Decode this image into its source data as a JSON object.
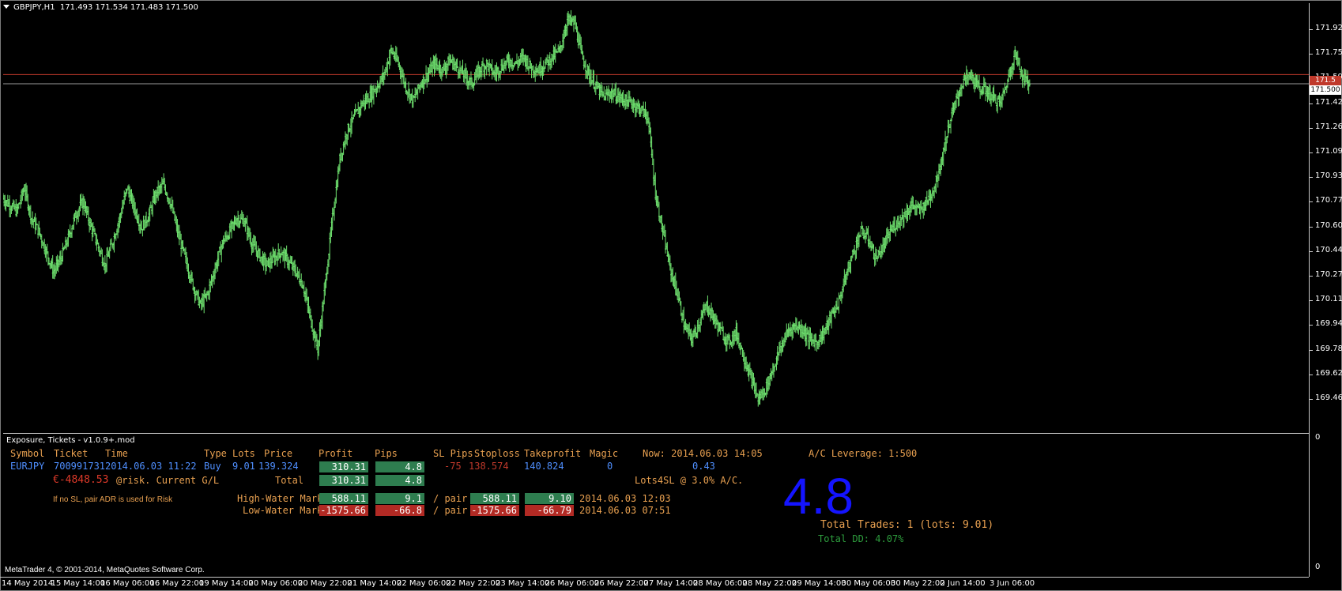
{
  "chart": {
    "title": "GBPJPY,H1  171.493 171.534 171.483 171.500",
    "y_ticks": [
      "171.920",
      "171.755",
      "171.590",
      "171.425",
      "171.260",
      "171.095",
      "170.930",
      "170.770",
      "170.605",
      "170.440",
      "170.275",
      "170.110",
      "169.945",
      "169.780",
      "169.620",
      "169.460"
    ],
    "price_tag_red": "171.5",
    "price_tag_white": "171.500",
    "x_labels": [
      "14 May 2014",
      "15 May 14:00",
      "16 May 06:00",
      "16 May 22:00",
      "19 May 14:00",
      "20 May 06:00",
      "20 May 22:00",
      "21 May 14:00",
      "22 May 06:00",
      "22 May 22:00",
      "23 May 14:00",
      "26 May 06:00",
      "26 May 22:00",
      "27 May 14:00",
      "28 May 06:00",
      "28 May 22:00",
      "29 May 14:00",
      "30 May 06:00",
      "30 May 22:00",
      "2 Jun 14:00",
      "3 Jun 06:00"
    ],
    "colors": {
      "candle": "#6ee06e",
      "red_line": "#c0392b",
      "grey_line": "#9a9a9a"
    }
  },
  "chart_data": {
    "type": "line",
    "title": "GBPJPY,H1",
    "ylim": [
      169.42,
      171.98
    ],
    "series": [
      {
        "values": [
          170.82,
          170.78,
          170.74,
          170.88,
          170.7,
          170.62,
          170.5,
          170.38,
          170.46,
          170.58,
          170.72,
          170.8,
          170.66,
          170.54,
          170.42,
          170.55,
          170.7,
          170.88,
          170.76,
          170.64,
          170.72,
          170.85,
          170.9,
          170.78,
          170.6,
          170.45,
          170.3,
          170.18,
          170.25,
          170.4,
          170.55,
          170.62,
          170.7,
          170.68,
          170.55,
          170.48,
          170.42,
          170.46,
          170.5,
          170.44,
          170.38,
          170.3,
          170.1,
          169.92,
          170.3,
          170.7,
          171.05,
          171.22,
          171.3,
          171.38,
          171.42,
          171.48,
          171.55,
          171.7,
          171.62,
          171.48,
          171.4,
          171.5,
          171.56,
          171.62,
          171.58,
          171.64,
          171.6,
          171.55,
          171.5,
          171.58,
          171.62,
          171.56,
          171.6,
          171.64,
          171.62,
          171.66,
          171.6,
          171.58,
          171.62,
          171.66,
          171.7,
          171.88,
          171.86,
          171.66,
          171.55,
          171.48,
          171.42,
          171.45,
          171.42,
          171.4,
          171.38,
          171.35,
          171.3,
          170.85,
          170.62,
          170.4,
          170.25,
          170.05,
          169.98,
          170.08,
          170.18,
          170.1,
          170.02,
          169.96,
          170.02,
          169.88,
          169.75,
          169.62,
          169.68,
          169.8,
          169.92,
          170.02,
          170.06,
          170.04,
          169.98,
          169.96,
          170.02,
          170.12,
          170.2,
          170.36,
          170.5,
          170.62,
          170.58,
          170.46,
          170.52,
          170.62,
          170.68,
          170.72,
          170.78,
          170.74,
          170.8,
          170.88,
          171.05,
          171.25,
          171.4,
          171.52,
          171.55,
          171.48,
          171.46,
          171.42,
          171.38,
          171.52,
          171.68,
          171.55,
          171.5
        ]
      }
    ]
  },
  "panel": {
    "title": "Exposure, Tickets - v1.0.9+.mod",
    "sub_y_top": "0",
    "sub_y_bottom": "0",
    "headers": {
      "symbol": "Symbol",
      "ticket": "Ticket",
      "time": "Time",
      "type": "Type",
      "lots": "Lots",
      "price": "Price",
      "profit": "Profit",
      "pips": "Pips",
      "slpips": "SL Pips",
      "stoploss": "Stoploss",
      "takeprofit": "Takeprofit",
      "magic": "Magic"
    },
    "now": "Now: 2014.06.03 14:05",
    "leverage": "A/C Leverage: 1:500",
    "row": {
      "symbol": "EURJPY",
      "ticket": "700991731",
      "time": "2014.06.03 11:22",
      "type": "Buy",
      "lots": "9.01",
      "price": "139.324",
      "profit": "310.31",
      "pips": "4.8",
      "slpips": "-75",
      "stoploss": "138.574",
      "takeprofit": "140.824",
      "magic": "0",
      "spread": "0.43"
    },
    "risk_amount": "€-4848.53",
    "risk_label": "@risk. Current G/L",
    "total_label": "Total",
    "total_profit": "310.31",
    "total_pips": "4.8",
    "lots4sl": "Lots4SL @ 3.0% A/C.",
    "note": "If no SL, pair ADR is used for Risk",
    "hwm": {
      "label": "High-Water Mark",
      "profit": "588.11",
      "pips": "9.1",
      "per_pair": "/ pair",
      "pair_profit": "588.11",
      "pair_pips": "9.10",
      "time": "2014.06.03 12:03"
    },
    "lwm": {
      "label": "Low-Water Mark",
      "profit": "-1575.66",
      "pips": "-66.8",
      "per_pair": "/ pair",
      "pair_profit": "-1575.66",
      "pair_pips": "-66.79",
      "time": "2014.06.03 07:51"
    },
    "big_value": "4.8",
    "total_trades": "Total Trades: 1 (lots: 9.01)",
    "total_dd": "Total DD: 4.07%",
    "copyright": "MetaTrader 4, © 2001-2014, MetaQuotes Software Corp."
  }
}
